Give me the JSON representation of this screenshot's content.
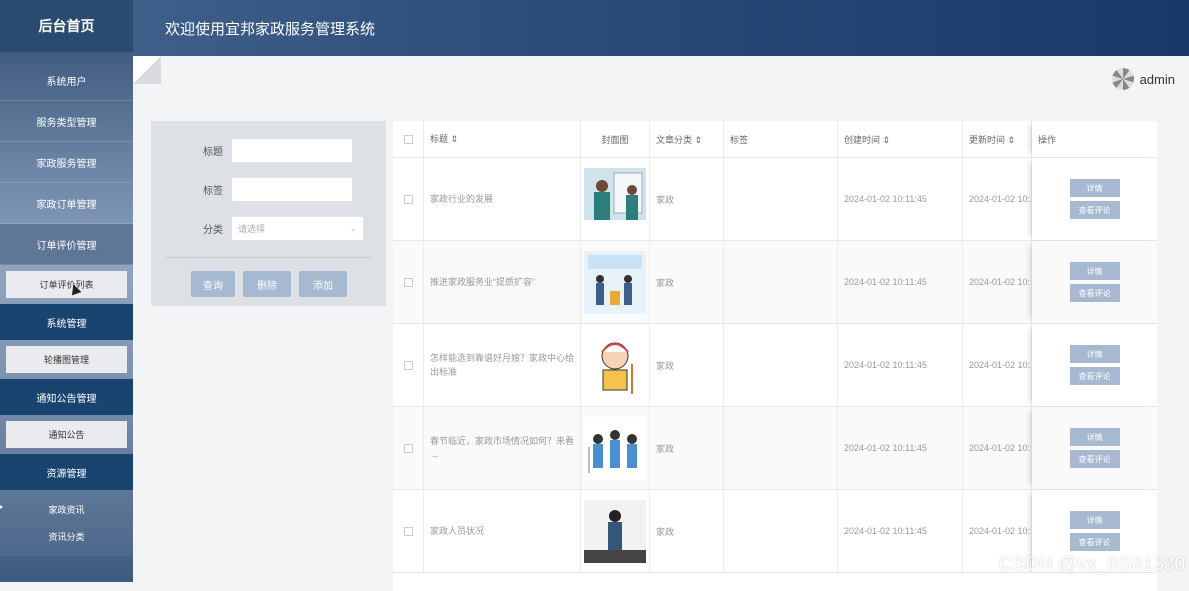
{
  "sidebar": {
    "brand": "后台首页",
    "items": [
      {
        "label": "系统用户"
      },
      {
        "label": "服务类型管理"
      },
      {
        "label": "家政服务管理"
      },
      {
        "label": "家政订单管理"
      },
      {
        "label": "订单评价管理"
      }
    ],
    "orderReviewSub": "订单评价列表",
    "systemGroup": "系统管理",
    "systemSub": "轮播图管理",
    "noticeGroup": "通知公告管理",
    "noticeSub": "通知公告",
    "resourceGroup": "资源管理",
    "resourceSubs": [
      {
        "label": "家政资讯"
      },
      {
        "label": "资讯分类"
      }
    ]
  },
  "header": {
    "title": "欢迎使用宜邦家政服务管理系统",
    "username": "admin"
  },
  "filter": {
    "title_label": "标题",
    "tag_label": "标签",
    "category_label": "分类",
    "category_placeholder": "请选择",
    "search_button": "查询",
    "delete_button": "删除",
    "add_button": "添加"
  },
  "table": {
    "headers": {
      "title": "标题 ⇕",
      "cover": "封面图",
      "category": "文章分类 ⇕",
      "tags": "标签",
      "created": "创建时间 ⇕",
      "updated": "更新时间 ⇕",
      "ops": "操作"
    },
    "rows": [
      {
        "title": "家政行业的发展",
        "category": "家政",
        "created": "2024-01-02 10:11:45",
        "updated": "2024-01-02 10:1"
      },
      {
        "title": "推进家政服务业“提质扩容”",
        "category": "家政",
        "created": "2024-01-02 10:11:45",
        "updated": "2024-01-02 10:1"
      },
      {
        "title": "怎样能选到靠谱好月嫂？家政中心给出标准",
        "category": "家政",
        "created": "2024-01-02 10:11:45",
        "updated": "2024-01-02 10:1"
      },
      {
        "title": "春节临近，家政市场情况如何？来看→",
        "category": "家政",
        "created": "2024-01-02 10:11:45",
        "updated": "2024-01-02 10:1"
      },
      {
        "title": "家政人员状况",
        "category": "家政",
        "created": "2024-01-02 10:11:45",
        "updated": "2024-01-02 10:1"
      }
    ],
    "detail_button": "详情",
    "comments_button": "查看评论"
  },
  "watermark": "CSDN @vx_BS81330"
}
